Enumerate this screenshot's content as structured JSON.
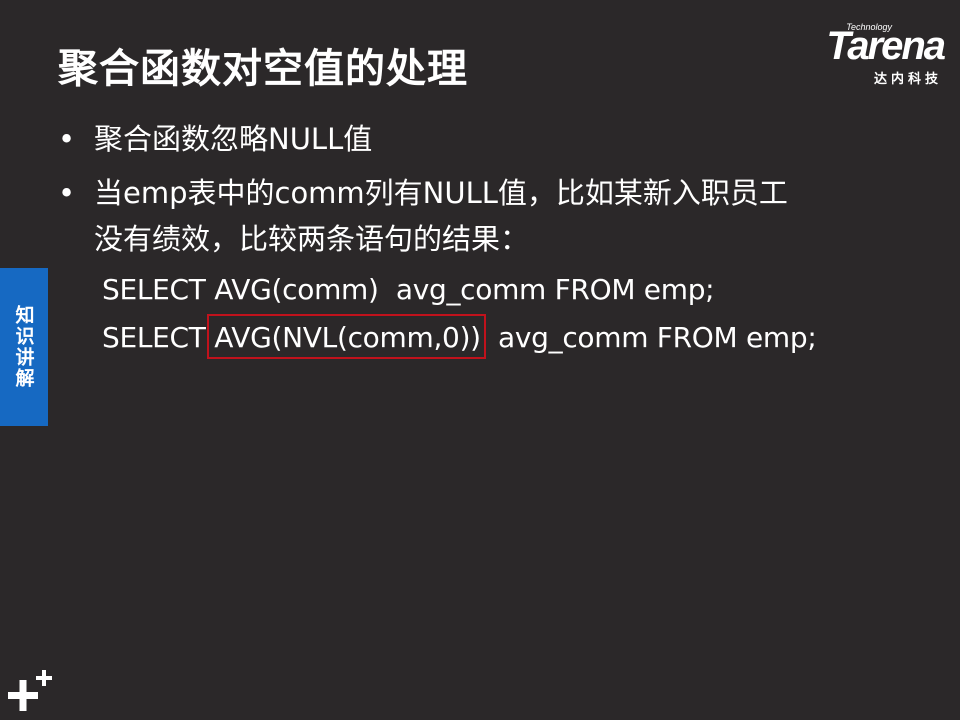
{
  "slide": {
    "title": "聚合函数对空值的处理",
    "bullets": [
      "聚合函数忽略NULL值",
      "当emp表中的comm列有NULL值，比如某新入职员工",
      "没有绩效，比较两条语句的结果："
    ],
    "code": [
      "SELECT AVG(comm)  avg_comm FROM emp;",
      "SELECT AVG(NVL(comm,0))  avg_comm FROM emp;"
    ]
  },
  "logo": {
    "tagline": "Technology",
    "name": "Tarena",
    "subtitle": "达内科技"
  },
  "side_tab": {
    "label": "知识讲解"
  },
  "icons": {
    "bullet": "•",
    "corner": "plus-icon"
  },
  "colors": {
    "background": "#2b2829",
    "side_tab": "#1669c2",
    "highlight_border": "#c1121c",
    "text": "#ffffff"
  }
}
